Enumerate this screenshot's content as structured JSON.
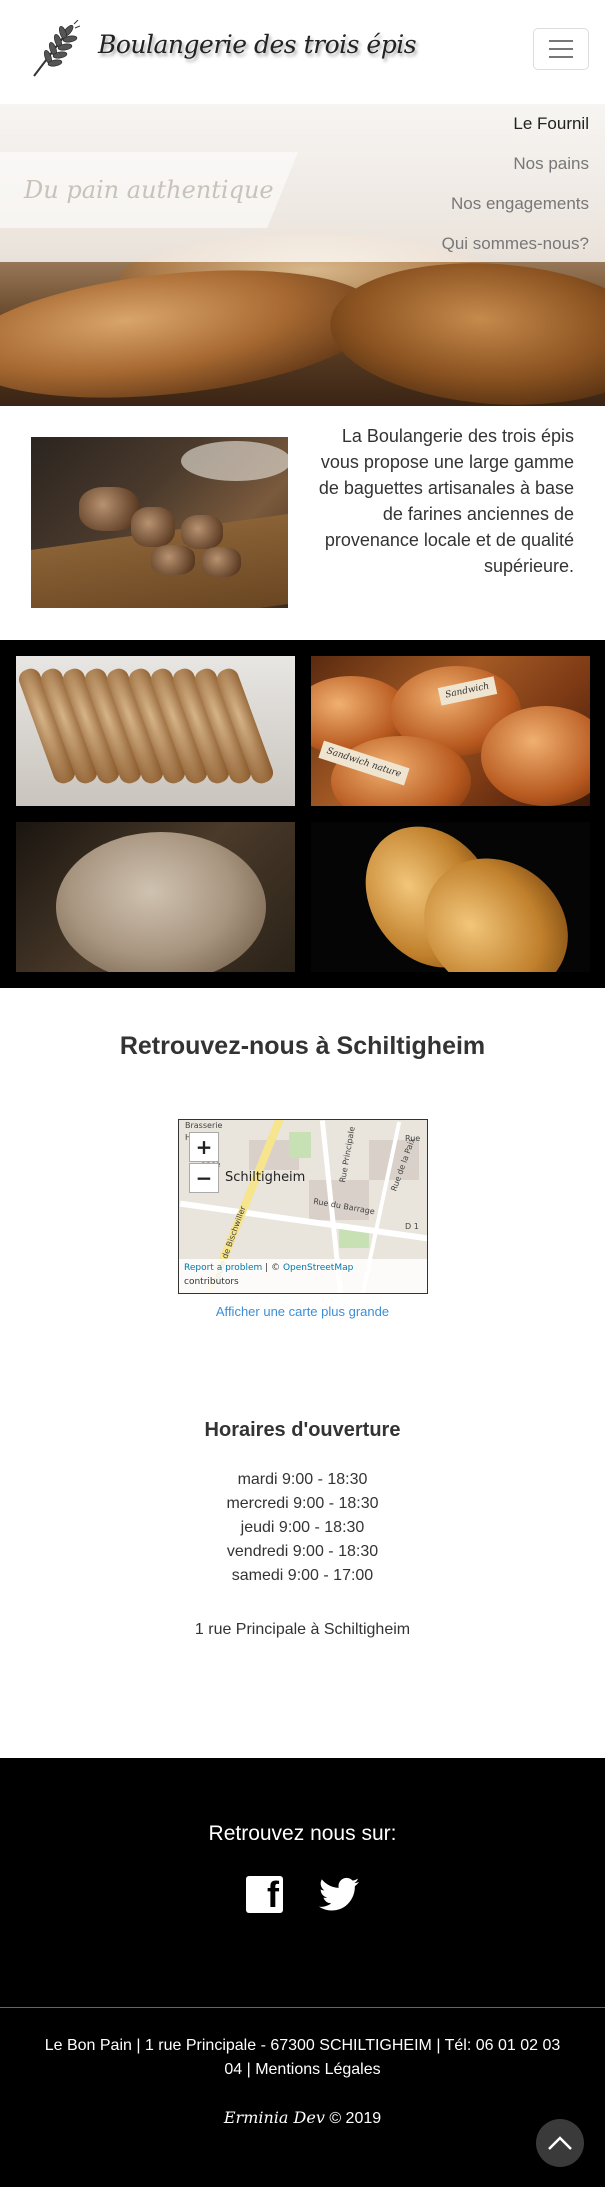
{
  "header": {
    "brand_name": "Boulangerie des trois épis",
    "logo_icon": "wheat-icon",
    "menu_toggle_icon": "hamburger-icon"
  },
  "nav": {
    "items": [
      {
        "label": "Le Fournil",
        "active": true
      },
      {
        "label": "Nos pains",
        "active": false
      },
      {
        "label": "Nos engagements",
        "active": false
      },
      {
        "label": "Qui sommes-nous?",
        "active": false
      }
    ]
  },
  "hero": {
    "tagline": "Du pain authentique"
  },
  "intro": {
    "text": "La Boulangerie des trois épis vous propose une large gamme de baguettes artisanales à base de farines anciennes de provenance locale et de qualité supérieure."
  },
  "gallery": {
    "labels": [
      "Sandwich",
      "Sandwich nature"
    ]
  },
  "location": {
    "title": "Retrouvez-nous à Schiltigheim",
    "map": {
      "zoom_in": "+",
      "zoom_out": "−",
      "city_label": "Schiltigheim",
      "attribution_report": "Report a problem",
      "attribution_sep": " | © ",
      "attribution_osm": "OpenStreetMap",
      "attribution_contrib": "contributors",
      "street_labels": [
        "Brasserie",
        "Hn",
        "en",
        "ance",
        "Rue du Barrage",
        "D 1",
        "Rue de la Paix",
        "Rue Principale",
        "Rue",
        "Route de Bischwiller"
      ]
    },
    "larger_map_link": "Afficher une carte plus grande"
  },
  "hours": {
    "title": "Horaires d'ouverture",
    "days": [
      "mardi 9:00 - 18:30",
      "mercredi 9:00 - 18:30",
      "jeudi 9:00 - 18:30",
      "vendredi 9:00 - 18:30",
      "samedi 9:00 - 17:00"
    ],
    "address": "1 rue Principale à Schiltigheim"
  },
  "footer": {
    "follow_title": "Retrouvez nous sur:",
    "social_icons": [
      "facebook-icon",
      "twitter-icon"
    ],
    "info_line": "Le Bon Pain  |  1 rue Principale - 67300 SCHILTIGHEIM  |  Tél: 06 01 02 03 04  |  Mentions Légales",
    "credit_author": "Erminia Dev",
    "credit_year": "© 2019",
    "back_to_top_icon": "chevron-up-icon"
  },
  "colors": {
    "link": "#3a8fd8",
    "footer_bg": "#000000",
    "gallery_bg": "#000000",
    "nav_active": "#222222",
    "nav_inactive": "#777777"
  }
}
